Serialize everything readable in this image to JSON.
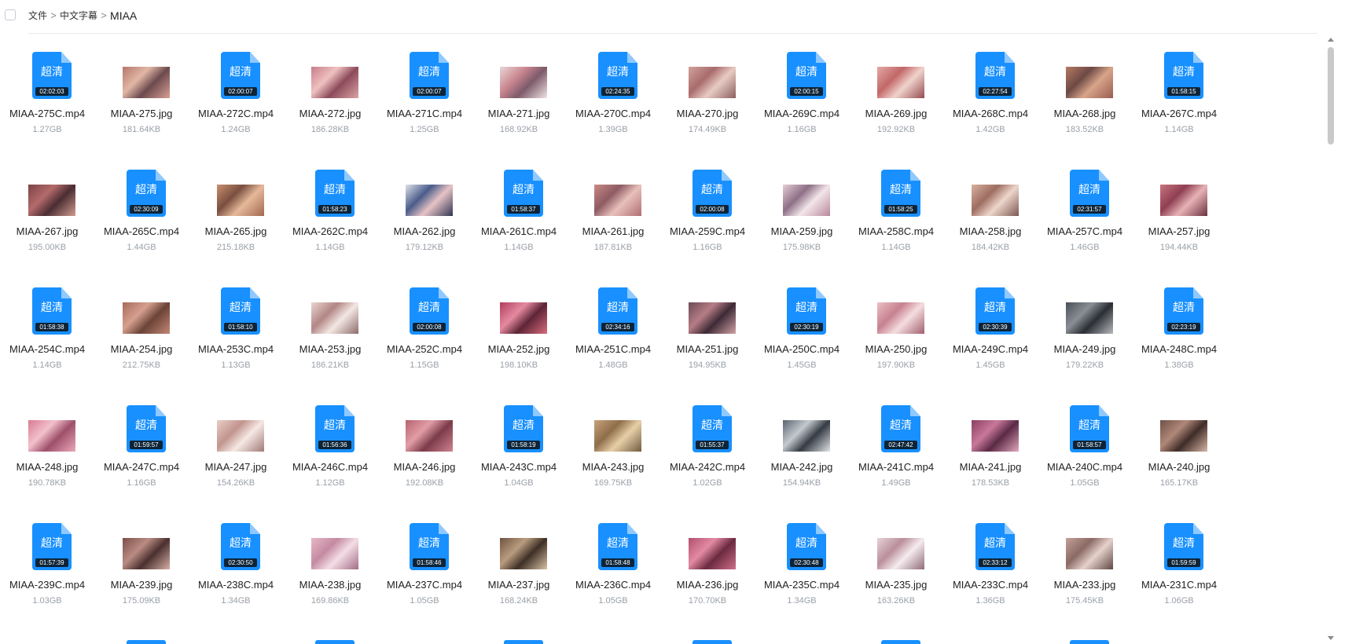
{
  "breadcrumb": [
    "文件",
    "中文字幕",
    "MIAA"
  ],
  "breadcrumb_separator": ">",
  "icon_badge_text": "超清",
  "icon_color": "#1890ff",
  "files": [
    {
      "name": "MIAA-275C.mp4",
      "size": "1.27GB",
      "type": "video",
      "duration": "02:02:03"
    },
    {
      "name": "MIAA-275.jpg",
      "size": "181.64KB",
      "type": "image",
      "thumb": [
        "#b4776a",
        "#e2b7a5",
        "#6c4a4e",
        "#d9a095"
      ]
    },
    {
      "name": "MIAA-272C.mp4",
      "size": "1.24GB",
      "type": "video",
      "duration": "02:00:07"
    },
    {
      "name": "MIAA-272.jpg",
      "size": "186.28KB",
      "type": "image",
      "thumb": [
        "#c77c8a",
        "#efc1c0",
        "#8c4b5b",
        "#dca3a6"
      ]
    },
    {
      "name": "MIAA-271C.mp4",
      "size": "1.25GB",
      "type": "video",
      "duration": "02:00:07"
    },
    {
      "name": "MIAA-271.jpg",
      "size": "168.92KB",
      "type": "image",
      "thumb": [
        "#e9d7d6",
        "#c9868f",
        "#7c5a6a",
        "#f2e4e4"
      ]
    },
    {
      "name": "MIAA-270C.mp4",
      "size": "1.39GB",
      "type": "video",
      "duration": "02:24:35"
    },
    {
      "name": "MIAA-270.jpg",
      "size": "174.49KB",
      "type": "image",
      "thumb": [
        "#d2a39a",
        "#a86b6c",
        "#e8cbc4",
        "#8c5f5f"
      ]
    },
    {
      "name": "MIAA-269C.mp4",
      "size": "1.16GB",
      "type": "video",
      "duration": "02:00:15"
    },
    {
      "name": "MIAA-269.jpg",
      "size": "192.92KB",
      "type": "image",
      "thumb": [
        "#e3a9a7",
        "#c26768",
        "#f1d3cd",
        "#944b4f"
      ]
    },
    {
      "name": "MIAA-268C.mp4",
      "size": "1.42GB",
      "type": "video",
      "duration": "02:27:54"
    },
    {
      "name": "MIAA-268.jpg",
      "size": "183.52KB",
      "type": "image",
      "thumb": [
        "#b77a62",
        "#6d4a45",
        "#d8a48a",
        "#9a5c4f"
      ]
    },
    {
      "name": "MIAA-267C.mp4",
      "size": "1.14GB",
      "type": "video",
      "duration": "01:58:15"
    },
    {
      "name": "MIAA-267.jpg",
      "size": "195.00KB",
      "type": "image",
      "thumb": [
        "#7c4346",
        "#b46a6a",
        "#4a2d33",
        "#d29c8f"
      ]
    },
    {
      "name": "MIAA-265C.mp4",
      "size": "1.44GB",
      "type": "video",
      "duration": "02:30:09"
    },
    {
      "name": "MIAA-265.jpg",
      "size": "215.18KB",
      "type": "image",
      "thumb": [
        "#c98f6f",
        "#7a4f3f",
        "#e6b99a",
        "#a0674f"
      ]
    },
    {
      "name": "MIAA-262C.mp4",
      "size": "1.14GB",
      "type": "video",
      "duration": "01:58:23"
    },
    {
      "name": "MIAA-262.jpg",
      "size": "179.12KB",
      "type": "image",
      "thumb": [
        "#dfe2ea",
        "#4a5c8a",
        "#e7c3c5",
        "#2e3553"
      ]
    },
    {
      "name": "MIAA-261C.mp4",
      "size": "1.14GB",
      "type": "video",
      "duration": "01:58:37"
    },
    {
      "name": "MIAA-261.jpg",
      "size": "187.81KB",
      "type": "image",
      "thumb": [
        "#c98a86",
        "#8e5b63",
        "#e8c1bb",
        "#b06d72"
      ]
    },
    {
      "name": "MIAA-259C.mp4",
      "size": "1.16GB",
      "type": "video",
      "duration": "02:00:08"
    },
    {
      "name": "MIAA-259.jpg",
      "size": "175.98KB",
      "type": "image",
      "thumb": [
        "#e5cfd6",
        "#8e6f86",
        "#f3e6ea",
        "#b8879a"
      ]
    },
    {
      "name": "MIAA-258C.mp4",
      "size": "1.14GB",
      "type": "video",
      "duration": "01:58:25"
    },
    {
      "name": "MIAA-258.jpg",
      "size": "184.42KB",
      "type": "image",
      "thumb": [
        "#d8b19f",
        "#9e6d61",
        "#edd6cb",
        "#7d5651"
      ]
    },
    {
      "name": "MIAA-257C.mp4",
      "size": "1.46GB",
      "type": "video",
      "duration": "02:31:57"
    },
    {
      "name": "MIAA-257.jpg",
      "size": "194.44KB",
      "type": "image",
      "thumb": [
        "#c9747f",
        "#8f3f52",
        "#e7b2b6",
        "#6b2f3e"
      ]
    },
    {
      "name": "MIAA-254C.mp4",
      "size": "1.14GB",
      "type": "video",
      "duration": "01:58:38"
    },
    {
      "name": "MIAA-254.jpg",
      "size": "212.75KB",
      "type": "image",
      "thumb": [
        "#a66a5b",
        "#d6a08f",
        "#6b4438",
        "#c48775"
      ]
    },
    {
      "name": "MIAA-253C.mp4",
      "size": "1.13GB",
      "type": "video",
      "duration": "01:58:10"
    },
    {
      "name": "MIAA-253.jpg",
      "size": "186.21KB",
      "type": "image",
      "thumb": [
        "#e9d6d2",
        "#b28785",
        "#f3e7e4",
        "#8c6a69"
      ]
    },
    {
      "name": "MIAA-252C.mp4",
      "size": "1.15GB",
      "type": "video",
      "duration": "02:00:08"
    },
    {
      "name": "MIAA-252.jpg",
      "size": "198.10KB",
      "type": "image",
      "thumb": [
        "#b03d5e",
        "#e58aa0",
        "#5d2536",
        "#d86b7d"
      ]
    },
    {
      "name": "MIAA-251C.mp4",
      "size": "1.48GB",
      "type": "video",
      "duration": "02:34:16"
    },
    {
      "name": "MIAA-251.jpg",
      "size": "194.95KB",
      "type": "image",
      "thumb": [
        "#6b4a55",
        "#b67d86",
        "#3d2a35",
        "#d2a2a6"
      ]
    },
    {
      "name": "MIAA-250C.mp4",
      "size": "1.45GB",
      "type": "video",
      "duration": "02:30:19"
    },
    {
      "name": "MIAA-250.jpg",
      "size": "197.90KB",
      "type": "image",
      "thumb": [
        "#eac0c3",
        "#c7818f",
        "#f5dde0",
        "#a05e6d"
      ]
    },
    {
      "name": "MIAA-249C.mp4",
      "size": "1.45GB",
      "type": "video",
      "duration": "02:30:39"
    },
    {
      "name": "MIAA-249.jpg",
      "size": "179.22KB",
      "type": "image",
      "thumb": [
        "#4a5058",
        "#8a8f95",
        "#2b2f35",
        "#b7b9bc"
      ]
    },
    {
      "name": "MIAA-248C.mp4",
      "size": "1.38GB",
      "type": "video",
      "duration": "02:23:19"
    },
    {
      "name": "MIAA-248.jpg",
      "size": "190.78KB",
      "type": "image",
      "thumb": [
        "#d97a92",
        "#f2c1cc",
        "#9e4f6a",
        "#ebaaba"
      ]
    },
    {
      "name": "MIAA-247C.mp4",
      "size": "1.16GB",
      "type": "video",
      "duration": "01:59:57"
    },
    {
      "name": "MIAA-247.jpg",
      "size": "154.26KB",
      "type": "image",
      "thumb": [
        "#e9cdc6",
        "#c1958e",
        "#f6e8e4",
        "#a07a76"
      ]
    },
    {
      "name": "MIAA-246C.mp4",
      "size": "1.12GB",
      "type": "video",
      "duration": "01:56:36"
    },
    {
      "name": "MIAA-246.jpg",
      "size": "192.08KB",
      "type": "image",
      "thumb": [
        "#b5626f",
        "#e29ea6",
        "#7c3b4a",
        "#cf8490"
      ]
    },
    {
      "name": "MIAA-243C.mp4",
      "size": "1.04GB",
      "type": "video",
      "duration": "01:58:19"
    },
    {
      "name": "MIAA-243.jpg",
      "size": "169.75KB",
      "type": "image",
      "thumb": [
        "#c9a27a",
        "#8e6e4a",
        "#e7cfa8",
        "#6e5a3f"
      ]
    },
    {
      "name": "MIAA-242C.mp4",
      "size": "1.02GB",
      "type": "video",
      "duration": "01:55:37"
    },
    {
      "name": "MIAA-242.jpg",
      "size": "154.94KB",
      "type": "image",
      "thumb": [
        "#5a6470",
        "#c4c9cf",
        "#353b44",
        "#e1e4e7"
      ]
    },
    {
      "name": "MIAA-241C.mp4",
      "size": "1.49GB",
      "type": "video",
      "duration": "02:47:42"
    },
    {
      "name": "MIAA-241.jpg",
      "size": "178.53KB",
      "type": "image",
      "thumb": [
        "#8a3f62",
        "#c9789a",
        "#5a2a45",
        "#e3a6bd"
      ]
    },
    {
      "name": "MIAA-240C.mp4",
      "size": "1.05GB",
      "type": "video",
      "duration": "01:58:57"
    },
    {
      "name": "MIAA-240.jpg",
      "size": "165.17KB",
      "type": "image",
      "thumb": [
        "#6e5147",
        "#b08878",
        "#3f2c28",
        "#d7b5a5"
      ]
    },
    {
      "name": "MIAA-239C.mp4",
      "size": "1.03GB",
      "type": "video",
      "duration": "01:57:39"
    },
    {
      "name": "MIAA-239.jpg",
      "size": "175.09KB",
      "type": "image",
      "thumb": [
        "#7d4f4c",
        "#b98b82",
        "#4a302f",
        "#d9b0a6"
      ]
    },
    {
      "name": "MIAA-238C.mp4",
      "size": "1.34GB",
      "type": "video",
      "duration": "02:30:50"
    },
    {
      "name": "MIAA-238.jpg",
      "size": "169.86KB",
      "type": "image",
      "thumb": [
        "#e7b8c6",
        "#c48aa1",
        "#f4dde5",
        "#a26d86"
      ]
    },
    {
      "name": "MIAA-237C.mp4",
      "size": "1.05GB",
      "type": "video",
      "duration": "01:58:46"
    },
    {
      "name": "MIAA-237.jpg",
      "size": "168.24KB",
      "type": "image",
      "thumb": [
        "#6e5440",
        "#b89c7f",
        "#3e2f25",
        "#d9c2a6"
      ]
    },
    {
      "name": "MIAA-236C.mp4",
      "size": "1.05GB",
      "type": "video",
      "duration": "01:58:48"
    },
    {
      "name": "MIAA-236.jpg",
      "size": "170.70KB",
      "type": "image",
      "thumb": [
        "#b04f6d",
        "#e38aa4",
        "#6b2a40",
        "#cf6f8b"
      ]
    },
    {
      "name": "MIAA-235C.mp4",
      "size": "1.34GB",
      "type": "video",
      "duration": "02:30:48"
    },
    {
      "name": "MIAA-235.jpg",
      "size": "163.26KB",
      "type": "image",
      "thumb": [
        "#e6d3d8",
        "#b98f9a",
        "#f5ecef",
        "#8f6c77"
      ]
    },
    {
      "name": "MIAA-233C.mp4",
      "size": "1.36GB",
      "type": "video",
      "duration": "02:33:12"
    },
    {
      "name": "MIAA-233.jpg",
      "size": "175.45KB",
      "type": "image",
      "thumb": [
        "#c3a199",
        "#8b6a65",
        "#e6d1cb",
        "#5f4743"
      ]
    },
    {
      "name": "MIAA-231C.mp4",
      "size": "1.06GB",
      "type": "video",
      "duration": "01:59:59"
    }
  ]
}
